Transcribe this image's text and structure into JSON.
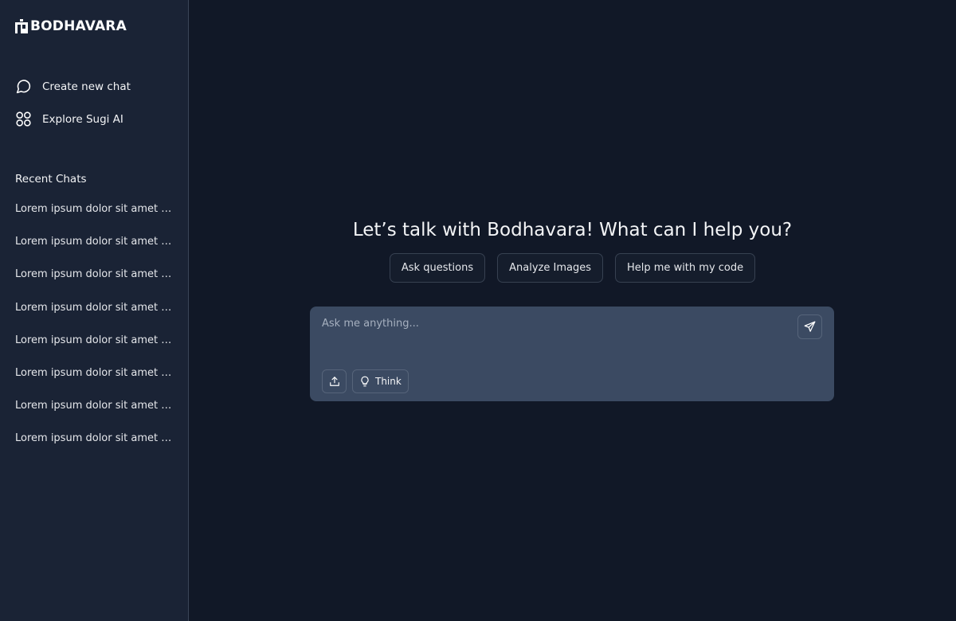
{
  "brand": {
    "name": "BODHAVARA"
  },
  "sidebar": {
    "nav": [
      {
        "label": "Create new chat",
        "icon": "chat-bubble-icon"
      },
      {
        "label": "Explore Sugi AI",
        "icon": "grid-circles-icon"
      }
    ],
    "recent_title": "Recent Chats",
    "recent_chats": [
      "Lorem ipsum dolor sit amet bla...",
      "Lorem ipsum dolor sit amet bla...",
      "Lorem ipsum dolor sit amet bla...",
      "Lorem ipsum dolor sit amet bla...",
      "Lorem ipsum dolor sit amet bla...",
      "Lorem ipsum dolor sit amet bla...",
      "Lorem ipsum dolor sit amet bla...",
      "Lorem ipsum dolor sit amet bla..."
    ]
  },
  "main": {
    "headline": "Let’s talk with Bodhavara! What can I help you?",
    "suggestions": [
      "Ask questions",
      "Analyze Images",
      "Help me with my code"
    ],
    "composer": {
      "placeholder": "Ask me anything...",
      "think_label": "Think",
      "send_icon": "send-icon",
      "upload_icon": "upload-icon",
      "think_icon": "lightbulb-icon"
    }
  },
  "colors": {
    "background": "#111827",
    "sidebar": "#1a2335",
    "composer": "#3b4a62"
  }
}
